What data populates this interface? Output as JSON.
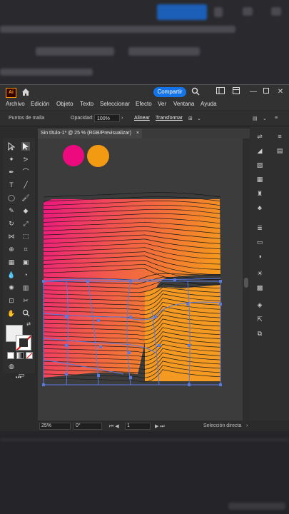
{
  "app": {
    "logo": "Ai",
    "share_label": "Compartir"
  },
  "menu": [
    "Archivo",
    "Edición",
    "Objeto",
    "Texto",
    "Seleccionar",
    "Efecto",
    "Ver",
    "Ventana",
    "Ayuda"
  ],
  "control_bar": {
    "mode_label": "Puntos de malla",
    "opacity_label": "Opacidad:",
    "opacity_value": "100%",
    "align_label": "Alinear",
    "transform_label": "Transformar"
  },
  "document_tab": {
    "title": "Sin título-1* @ 25 % (RGB/Previsualizar)",
    "close": "×"
  },
  "swatches": [
    {
      "name": "magenta",
      "color": "#ec0a7e"
    },
    {
      "name": "orange",
      "color": "#f39a13"
    }
  ],
  "status": {
    "zoom": "25%",
    "rotation": "0°",
    "artboard": "1",
    "tool_name": "Selección directa"
  },
  "colors": {
    "accent": "#1473e6",
    "mesh_line": "#5b7ae0"
  }
}
